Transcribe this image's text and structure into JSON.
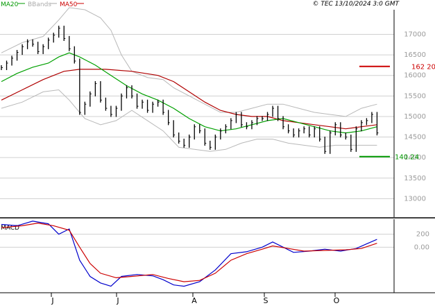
{
  "header": {
    "legend": [
      {
        "label": "MA20",
        "color": "#009900"
      },
      {
        "label": "BBands",
        "color": "#aaaaaa"
      },
      {
        "label": "MA50",
        "color": "#cc0000"
      }
    ],
    "copyright": "© TEC 13/10/2024 3:0 GMT"
  },
  "levels": [
    {
      "label": "162 20",
      "value": 16220,
      "color": "#cc0000"
    },
    {
      "label": "140.24",
      "value": 14024,
      "color": "#009900"
    }
  ],
  "chart_data": [
    {
      "type": "line",
      "title": "",
      "y_ticks": [
        13000,
        13500,
        14000,
        14500,
        15000,
        15500,
        16000,
        16500,
        17000
      ],
      "y_tick_labels": [
        "13000",
        "13500",
        "14000",
        "14500",
        "15000",
        "15500",
        "16000",
        "16500",
        "17000"
      ],
      "ylim": [
        12550,
        17600
      ],
      "x_tick_labels": [
        "J",
        "J",
        "A",
        "S",
        "O"
      ],
      "grid": true,
      "price": [
        {
          "t": 0,
          "v": 16190
        },
        {
          "t": 2,
          "v": 16300
        },
        {
          "t": 4,
          "v": 16420
        },
        {
          "t": 6,
          "v": 16560
        },
        {
          "t": 8,
          "v": 16700
        },
        {
          "t": 10,
          "v": 16820
        },
        {
          "t": 12,
          "v": 16760
        },
        {
          "t": 14,
          "v": 16580
        },
        {
          "t": 16,
          "v": 16700
        },
        {
          "t": 18,
          "v": 16860
        },
        {
          "t": 20,
          "v": 16980
        },
        {
          "t": 22,
          "v": 17150
        },
        {
          "t": 24,
          "v": 16900
        },
        {
          "t": 26,
          "v": 16650
        },
        {
          "t": 28,
          "v": 16350
        },
        {
          "t": 30,
          "v": 15100
        },
        {
          "t": 32,
          "v": 15300
        },
        {
          "t": 34,
          "v": 15550
        },
        {
          "t": 36,
          "v": 15800
        },
        {
          "t": 38,
          "v": 15400
        },
        {
          "t": 40,
          "v": 15200
        },
        {
          "t": 42,
          "v": 15050
        },
        {
          "t": 44,
          "v": 15200
        },
        {
          "t": 46,
          "v": 15500
        },
        {
          "t": 48,
          "v": 15700
        },
        {
          "t": 50,
          "v": 15500
        },
        {
          "t": 52,
          "v": 15250
        },
        {
          "t": 54,
          "v": 15350
        },
        {
          "t": 56,
          "v": 15150
        },
        {
          "t": 58,
          "v": 15300
        },
        {
          "t": 60,
          "v": 15350
        },
        {
          "t": 62,
          "v": 15100
        },
        {
          "t": 64,
          "v": 14850
        },
        {
          "t": 66,
          "v": 14550
        },
        {
          "t": 68,
          "v": 14400
        },
        {
          "t": 70,
          "v": 14300
        },
        {
          "t": 72,
          "v": 14500
        },
        {
          "t": 74,
          "v": 14750
        },
        {
          "t": 76,
          "v": 14650
        },
        {
          "t": 78,
          "v": 14350
        },
        {
          "t": 80,
          "v": 14250
        },
        {
          "t": 82,
          "v": 14500
        },
        {
          "t": 84,
          "v": 14650
        },
        {
          "t": 86,
          "v": 14750
        },
        {
          "t": 88,
          "v": 14900
        },
        {
          "t": 90,
          "v": 15050
        },
        {
          "t": 92,
          "v": 14800
        },
        {
          "t": 94,
          "v": 14750
        },
        {
          "t": 96,
          "v": 14850
        },
        {
          "t": 98,
          "v": 14950
        },
        {
          "t": 100,
          "v": 14950
        },
        {
          "t": 102,
          "v": 15050
        },
        {
          "t": 104,
          "v": 15200
        },
        {
          "t": 106,
          "v": 14950
        },
        {
          "t": 108,
          "v": 14750
        },
        {
          "t": 110,
          "v": 14650
        },
        {
          "t": 112,
          "v": 14550
        },
        {
          "t": 114,
          "v": 14650
        },
        {
          "t": 116,
          "v": 14700
        },
        {
          "t": 118,
          "v": 14550
        },
        {
          "t": 120,
          "v": 14700
        },
        {
          "t": 122,
          "v": 14450
        },
        {
          "t": 124,
          "v": 14150
        },
        {
          "t": 126,
          "v": 14600
        },
        {
          "t": 128,
          "v": 14800
        },
        {
          "t": 130,
          "v": 14550
        },
        {
          "t": 132,
          "v": 14500
        },
        {
          "t": 134,
          "v": 14200
        },
        {
          "t": 136,
          "v": 14700
        },
        {
          "t": 138,
          "v": 14850
        },
        {
          "t": 140,
          "v": 14900
        },
        {
          "t": 142,
          "v": 15050
        },
        {
          "t": 144,
          "v": 14600
        }
      ],
      "ma20": [
        {
          "t": 0,
          "v": 15850
        },
        {
          "t": 6,
          "v": 16050
        },
        {
          "t": 12,
          "v": 16200
        },
        {
          "t": 18,
          "v": 16300
        },
        {
          "t": 22,
          "v": 16450
        },
        {
          "t": 26,
          "v": 16550
        },
        {
          "t": 30,
          "v": 16450
        },
        {
          "t": 36,
          "v": 16250
        },
        {
          "t": 42,
          "v": 16000
        },
        {
          "t": 48,
          "v": 15750
        },
        {
          "t": 54,
          "v": 15550
        },
        {
          "t": 60,
          "v": 15400
        },
        {
          "t": 66,
          "v": 15200
        },
        {
          "t": 72,
          "v": 14950
        },
        {
          "t": 78,
          "v": 14750
        },
        {
          "t": 84,
          "v": 14650
        },
        {
          "t": 90,
          "v": 14700
        },
        {
          "t": 96,
          "v": 14800
        },
        {
          "t": 102,
          "v": 14900
        },
        {
          "t": 108,
          "v": 14950
        },
        {
          "t": 114,
          "v": 14850
        },
        {
          "t": 120,
          "v": 14750
        },
        {
          "t": 126,
          "v": 14650
        },
        {
          "t": 132,
          "v": 14600
        },
        {
          "t": 138,
          "v": 14650
        },
        {
          "t": 144,
          "v": 14750
        }
      ],
      "ma50": [
        {
          "t": 0,
          "v": 15400
        },
        {
          "t": 8,
          "v": 15650
        },
        {
          "t": 16,
          "v": 15900
        },
        {
          "t": 24,
          "v": 16100
        },
        {
          "t": 30,
          "v": 16150
        },
        {
          "t": 40,
          "v": 16150
        },
        {
          "t": 50,
          "v": 16100
        },
        {
          "t": 60,
          "v": 16000
        },
        {
          "t": 66,
          "v": 15850
        },
        {
          "t": 72,
          "v": 15600
        },
        {
          "t": 78,
          "v": 15350
        },
        {
          "t": 84,
          "v": 15150
        },
        {
          "t": 90,
          "v": 15050
        },
        {
          "t": 96,
          "v": 15000
        },
        {
          "t": 102,
          "v": 15000
        },
        {
          "t": 108,
          "v": 14900
        },
        {
          "t": 114,
          "v": 14850
        },
        {
          "t": 120,
          "v": 14800
        },
        {
          "t": 126,
          "v": 14750
        },
        {
          "t": 132,
          "v": 14700
        },
        {
          "t": 138,
          "v": 14750
        },
        {
          "t": 144,
          "v": 14800
        }
      ],
      "bb_upper": [
        {
          "t": 0,
          "v": 16550
        },
        {
          "t": 8,
          "v": 16800
        },
        {
          "t": 16,
          "v": 16950
        },
        {
          "t": 22,
          "v": 17350
        },
        {
          "t": 26,
          "v": 17650
        },
        {
          "t": 32,
          "v": 17600
        },
        {
          "t": 38,
          "v": 17400
        },
        {
          "t": 42,
          "v": 17100
        },
        {
          "t": 46,
          "v": 16500
        },
        {
          "t": 50,
          "v": 16100
        },
        {
          "t": 56,
          "v": 15950
        },
        {
          "t": 62,
          "v": 15900
        },
        {
          "t": 66,
          "v": 15700
        },
        {
          "t": 72,
          "v": 15500
        },
        {
          "t": 78,
          "v": 15300
        },
        {
          "t": 84,
          "v": 15100
        },
        {
          "t": 90,
          "v": 15100
        },
        {
          "t": 96,
          "v": 15200
        },
        {
          "t": 102,
          "v": 15300
        },
        {
          "t": 108,
          "v": 15300
        },
        {
          "t": 114,
          "v": 15200
        },
        {
          "t": 120,
          "v": 15100
        },
        {
          "t": 126,
          "v": 15050
        },
        {
          "t": 132,
          "v": 15000
        },
        {
          "t": 138,
          "v": 15200
        },
        {
          "t": 144,
          "v": 15300
        }
      ],
      "bb_lower": [
        {
          "t": 0,
          "v": 15200
        },
        {
          "t": 8,
          "v": 15350
        },
        {
          "t": 16,
          "v": 15600
        },
        {
          "t": 22,
          "v": 15650
        },
        {
          "t": 26,
          "v": 15400
        },
        {
          "t": 32,
          "v": 14950
        },
        {
          "t": 38,
          "v": 14800
        },
        {
          "t": 44,
          "v": 14900
        },
        {
          "t": 50,
          "v": 15150
        },
        {
          "t": 56,
          "v": 14900
        },
        {
          "t": 62,
          "v": 14650
        },
        {
          "t": 68,
          "v": 14250
        },
        {
          "t": 74,
          "v": 14200
        },
        {
          "t": 80,
          "v": 14150
        },
        {
          "t": 86,
          "v": 14200
        },
        {
          "t": 92,
          "v": 14350
        },
        {
          "t": 98,
          "v": 14450
        },
        {
          "t": 104,
          "v": 14450
        },
        {
          "t": 110,
          "v": 14350
        },
        {
          "t": 116,
          "v": 14300
        },
        {
          "t": 122,
          "v": 14250
        },
        {
          "t": 128,
          "v": 14300
        },
        {
          "t": 134,
          "v": 14300
        },
        {
          "t": 140,
          "v": 14300
        },
        {
          "t": 144,
          "v": 14300
        }
      ]
    },
    {
      "type": "line",
      "title": "MACD",
      "y_ticks": [
        200,
        0
      ],
      "y_tick_labels": [
        "200",
        "0.00"
      ],
      "ylim": [
        -700,
        430
      ],
      "grid": true,
      "series": [
        {
          "color": "#0000cc",
          "points": [
            {
              "t": 0,
              "v": 350
            },
            {
              "t": 6,
              "v": 330
            },
            {
              "t": 12,
              "v": 400
            },
            {
              "t": 18,
              "v": 360
            },
            {
              "t": 22,
              "v": 200
            },
            {
              "t": 26,
              "v": 280
            },
            {
              "t": 30,
              "v": -200
            },
            {
              "t": 34,
              "v": -450
            },
            {
              "t": 38,
              "v": -550
            },
            {
              "t": 42,
              "v": -600
            },
            {
              "t": 46,
              "v": -450
            },
            {
              "t": 52,
              "v": -420
            },
            {
              "t": 58,
              "v": -440
            },
            {
              "t": 62,
              "v": -500
            },
            {
              "t": 66,
              "v": -580
            },
            {
              "t": 70,
              "v": -600
            },
            {
              "t": 76,
              "v": -530
            },
            {
              "t": 82,
              "v": -350
            },
            {
              "t": 88,
              "v": -100
            },
            {
              "t": 94,
              "v": -70
            },
            {
              "t": 100,
              "v": 0
            },
            {
              "t": 104,
              "v": 80
            },
            {
              "t": 108,
              "v": 0
            },
            {
              "t": 112,
              "v": -80
            },
            {
              "t": 118,
              "v": -60
            },
            {
              "t": 124,
              "v": -30
            },
            {
              "t": 130,
              "v": -60
            },
            {
              "t": 136,
              "v": -20
            },
            {
              "t": 140,
              "v": 50
            },
            {
              "t": 144,
              "v": 120
            }
          ]
        },
        {
          "color": "#cc0000",
          "points": [
            {
              "t": 0,
              "v": 300
            },
            {
              "t": 8,
              "v": 330
            },
            {
              "t": 14,
              "v": 370
            },
            {
              "t": 20,
              "v": 330
            },
            {
              "t": 26,
              "v": 260
            },
            {
              "t": 30,
              "v": 0
            },
            {
              "t": 34,
              "v": -250
            },
            {
              "t": 38,
              "v": -400
            },
            {
              "t": 44,
              "v": -470
            },
            {
              "t": 50,
              "v": -450
            },
            {
              "t": 58,
              "v": -420
            },
            {
              "t": 64,
              "v": -480
            },
            {
              "t": 70,
              "v": -530
            },
            {
              "t": 76,
              "v": -510
            },
            {
              "t": 82,
              "v": -400
            },
            {
              "t": 88,
              "v": -200
            },
            {
              "t": 94,
              "v": -100
            },
            {
              "t": 100,
              "v": -30
            },
            {
              "t": 104,
              "v": 20
            },
            {
              "t": 110,
              "v": -20
            },
            {
              "t": 116,
              "v": -60
            },
            {
              "t": 124,
              "v": -50
            },
            {
              "t": 132,
              "v": -40
            },
            {
              "t": 138,
              "v": -20
            },
            {
              "t": 144,
              "v": 60
            }
          ]
        }
      ]
    }
  ]
}
